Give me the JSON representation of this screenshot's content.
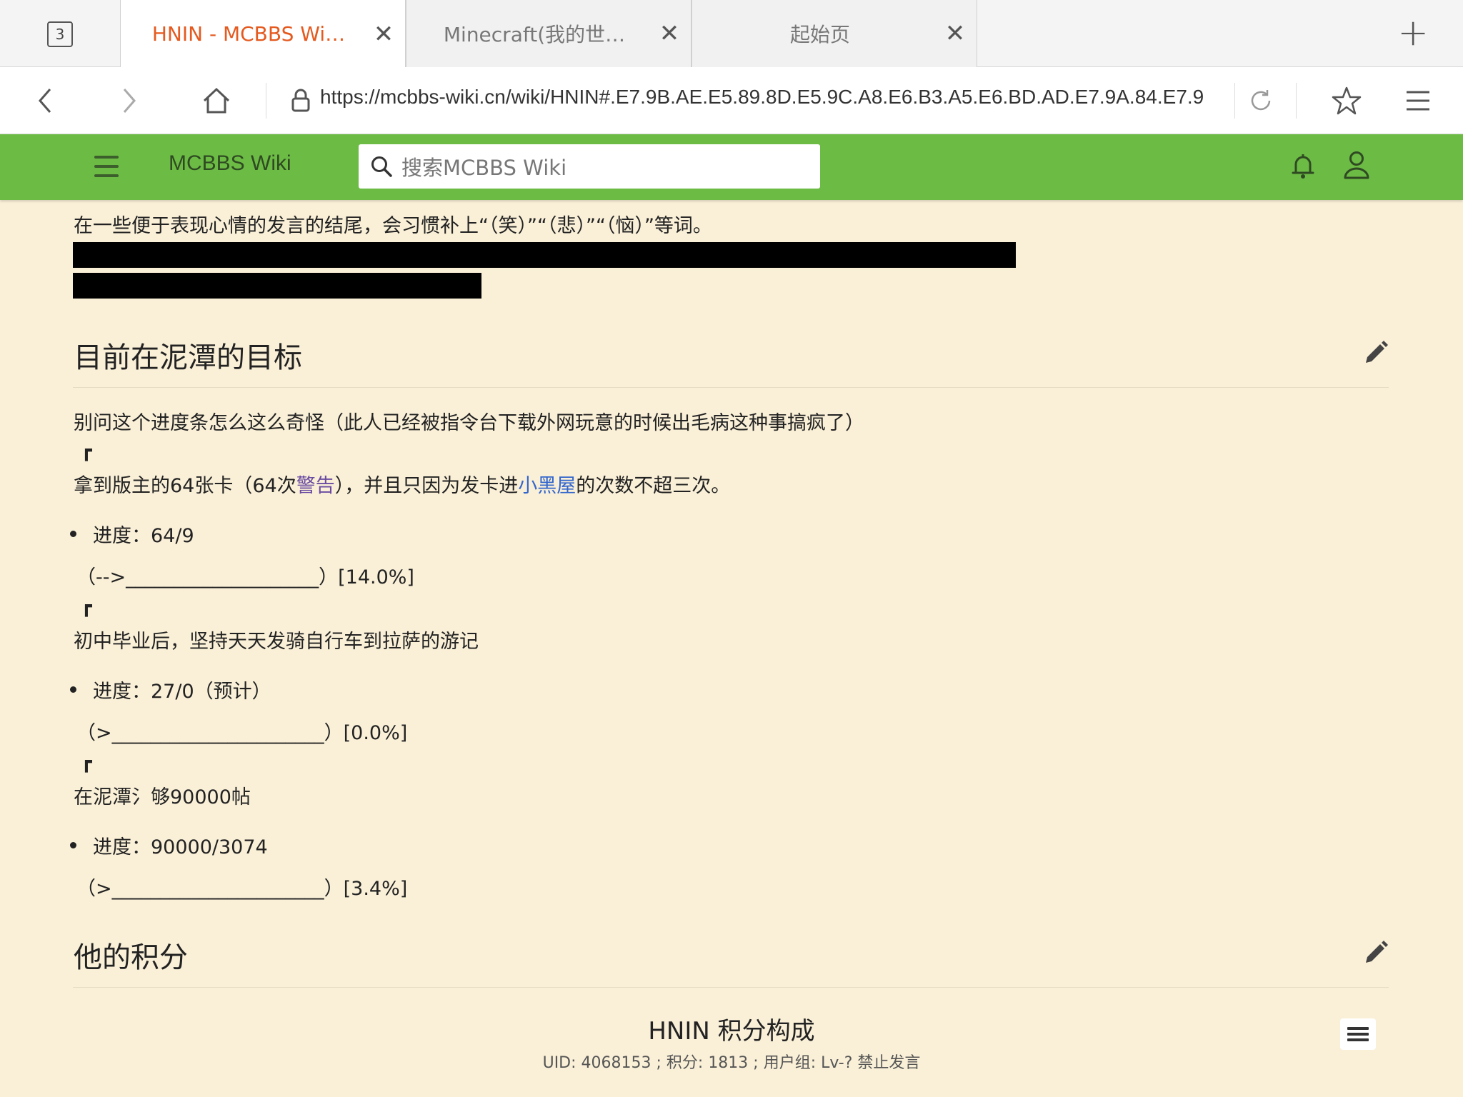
{
  "browser": {
    "tab_count": "3",
    "tabs": [
      {
        "title": "HNIN - MCBBS Wi…",
        "close": "✕"
      },
      {
        "title": "Minecraft(我的世…",
        "close": "✕"
      },
      {
        "title": "起始页",
        "close": "✕"
      }
    ],
    "new_tab": "+",
    "url": "https://mcbbs-wiki.cn/wiki/HNIN#.E7.9B.AE.E5.89.8D.E5.9C.A8.E6.B3.A5.E6.BD.AD.E7.9A.84.E7.9"
  },
  "wiki_header": {
    "brand": "MCBBS Wiki",
    "search_placeholder": "搜索MCBBS Wiki"
  },
  "content": {
    "cut_line": "…",
    "intro_line": "在一些便于表现心情的发言的结尾，会习惯补上“（笑）”“（悲）”“（恼）”等词。",
    "section1": {
      "heading": "目前在泥潭的目标",
      "note": "别问这个进度条怎么这么奇怪（此人已经被指令台下载外网玩意的时候出毛病这种事搞疯了）",
      "corner": "┏",
      "goals": [
        {
          "title_pre": "拿到版主的64张卡（64次",
          "link1": "警告",
          "title_mid": "），并且只因为发卡进",
          "link2": "小黑屋",
          "title_post": "的次数不超三次。",
          "progress_label": "进度：64/9",
          "progress_bar": "（-->____________________）[14.0%]"
        },
        {
          "title": "初中毕业后，坚持天天发骑自行车到拉萨的游记",
          "progress_label": "进度：27/0（预计）",
          "progress_bar": "（>______________________）[0.0%]"
        },
        {
          "title": "在泥潭氵够90000帖",
          "progress_label": "进度：90000/3074",
          "progress_bar": "（>______________________）[3.4%]"
        }
      ]
    },
    "section2": {
      "heading": "他的积分",
      "table_title": "HNIN 积分构成",
      "table_sub": "UID: 4068153 ; 积分: 1813 ; 用户组: Lv-? 禁止发言"
    }
  },
  "colors": {
    "header_green": "#6cbb45",
    "page_bg": "#faf0d8",
    "active_tab": "#e45a1f",
    "link_blue": "#3366cc",
    "link_purple": "#6b4ba1"
  }
}
